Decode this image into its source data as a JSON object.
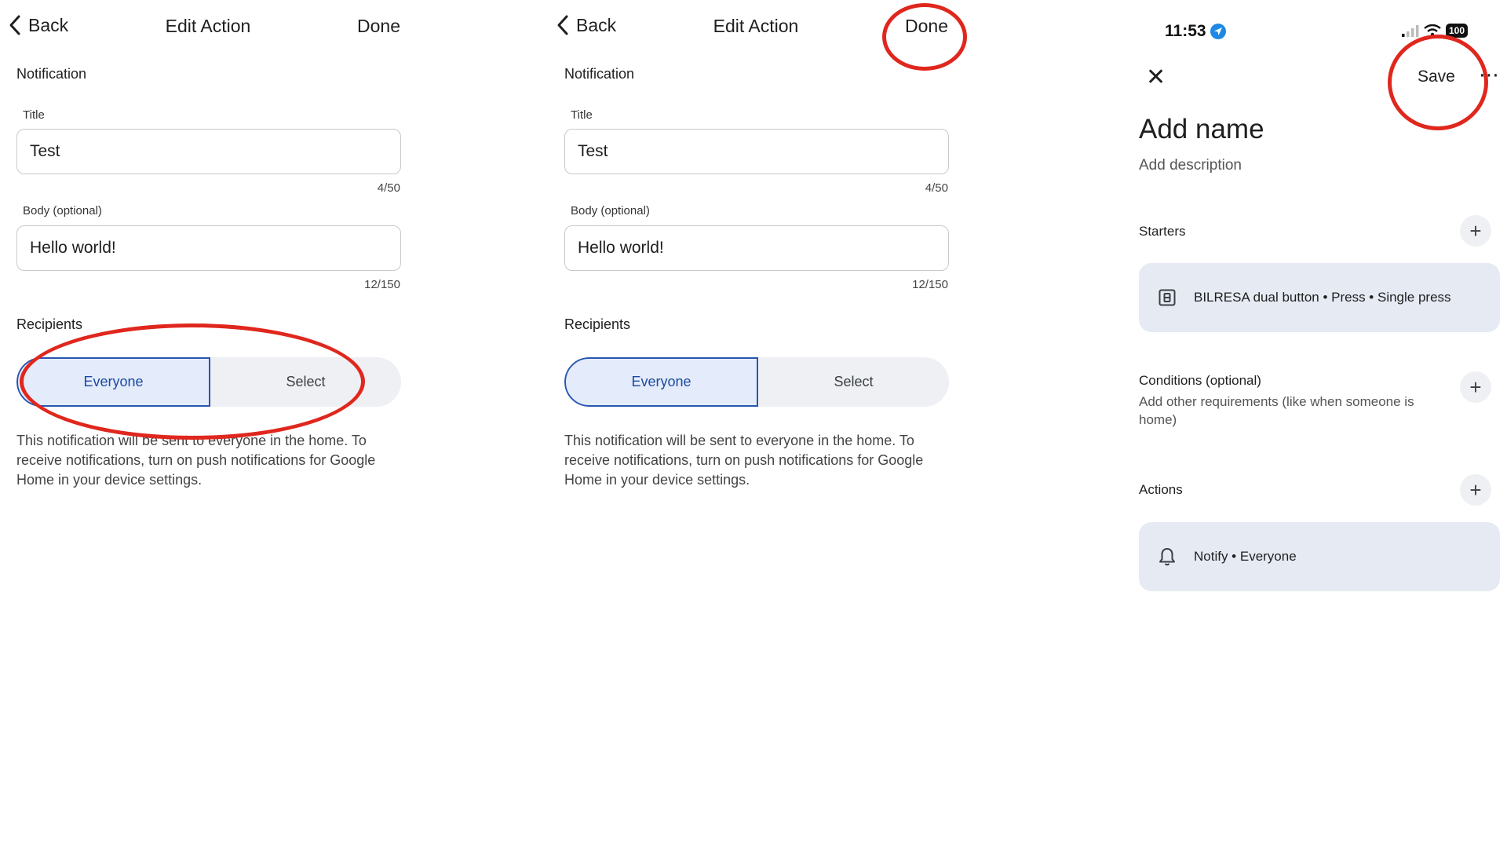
{
  "panel1": {
    "back_label": "Back",
    "title": "Edit Action",
    "done_label": "Done",
    "section_label": "Notification",
    "title_field_label": "Title",
    "title_value": "Test",
    "title_counter": "4/50",
    "body_field_label": "Body (optional)",
    "body_value": "Hello world!",
    "body_counter": "12/150",
    "recipients_label": "Recipients",
    "option_everyone": "Everyone",
    "option_select": "Select",
    "description": "This notification will be sent to everyone in the home. To receive notifications, turn on push notifications for Google Home in your device settings."
  },
  "panel2": {
    "back_label": "Back",
    "title": "Edit Action",
    "done_label": "Done",
    "section_label": "Notification",
    "title_field_label": "Title",
    "title_value": "Test",
    "title_counter": "4/50",
    "body_field_label": "Body (optional)",
    "body_value": "Hello world!",
    "body_counter": "12/150",
    "recipients_label": "Recipients",
    "option_everyone": "Everyone",
    "option_select": "Select",
    "description": "This notification will be sent to everyone in the home. To receive notifications, turn on push notifications for Google Home in your device settings."
  },
  "panel3": {
    "status_time": "11:53",
    "battery": "100",
    "save_label": "Save",
    "name_placeholder": "Add name",
    "description_placeholder": "Add description",
    "starters_label": "Starters",
    "starter_item": "BILRESA dual button • Press • Single press",
    "conditions_label": "Conditions (optional)",
    "conditions_hint": "Add other requirements (like when someone is home)",
    "actions_label": "Actions",
    "action_item": "Notify • Everyone"
  },
  "colors": {
    "annotation": "#e0271d",
    "selected_border": "#2855b0",
    "selected_fill": "#e4ebfb",
    "card_fill": "#e6eaf3"
  },
  "icons": [
    "chevron-left-icon",
    "close-icon",
    "more-icon",
    "plus-icon",
    "button-device-icon",
    "bell-icon",
    "location-arrow-icon",
    "signal-icon",
    "wifi-icon",
    "battery-icon"
  ]
}
